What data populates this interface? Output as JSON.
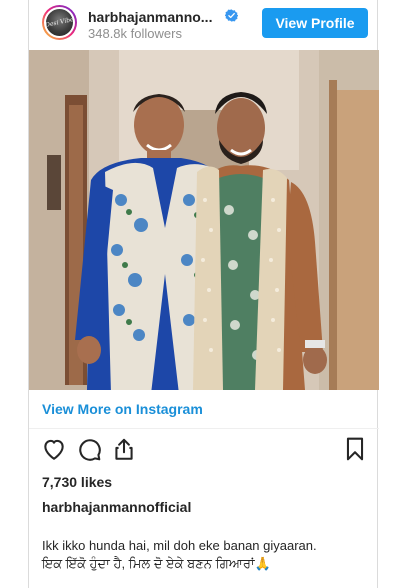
{
  "header": {
    "avatar_text": "Desi Vibe",
    "username": "harbhajanmanno...",
    "followers": "348.8k followers",
    "view_profile_label": "View Profile",
    "verified_icon": "verified-badge-icon"
  },
  "post": {
    "image_icon": "photo-two-men-in-floral-jackets",
    "view_more_label": "View More on Instagram",
    "likes": "7,730 likes",
    "owner": "harbhajanmannofficial",
    "caption_line1": "Ikk ikko hunda hai, mil doh eke banan giyaaran.",
    "caption_line2": "ਇਕ ਇੱਕੋ ਹੁੰਦਾ ਹੈ, ਮਿਲ ਦੋ ਏਕੇ ਬਣਨ ਗਿਆਰਾਂ🙏"
  },
  "actions": {
    "like_icon": "heart-icon",
    "comment_icon": "comment-icon",
    "share_icon": "share-icon",
    "save_icon": "bookmark-icon"
  },
  "colors": {
    "accent": "#1a9bf0",
    "link": "#1a8fd8",
    "text": "#262626",
    "muted": "#8e8e8e"
  }
}
